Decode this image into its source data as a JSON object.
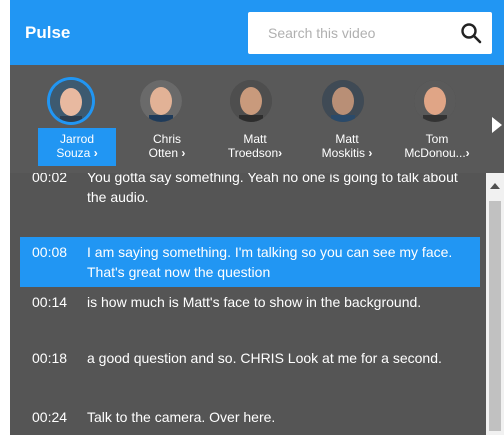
{
  "header": {
    "brand": "Pulse",
    "search_placeholder": "Search this video"
  },
  "speakers": [
    {
      "first": "Jarrod",
      "last": "Souza",
      "selected": true
    },
    {
      "first": "Chris",
      "last": "Otten",
      "selected": false
    },
    {
      "first": "Matt",
      "last": "Troedson",
      "selected": false
    },
    {
      "first": "Matt",
      "last": "Moskitis",
      "selected": false
    },
    {
      "first": "Tom",
      "last": "McDonou...",
      "selected": false
    }
  ],
  "transcript": [
    {
      "time": "00:02",
      "text": "You gotta say something. Yeah no one is going to talk about the audio."
    },
    {
      "time": "00:08",
      "text": "I am saying something. I'm talking so you can see my face. That's great now the question",
      "active": true
    },
    {
      "time": "00:14",
      "text": "is how much is Matt's face to show in the background."
    },
    {
      "time": "00:18",
      "text": "a good question and so. CHRIS Look at me for a second."
    },
    {
      "time": "00:24",
      "text": "Talk to the camera. Over here."
    }
  ],
  "colors": {
    "accent": "#2196f3",
    "panel": "#555555",
    "text": "#ffffff"
  }
}
